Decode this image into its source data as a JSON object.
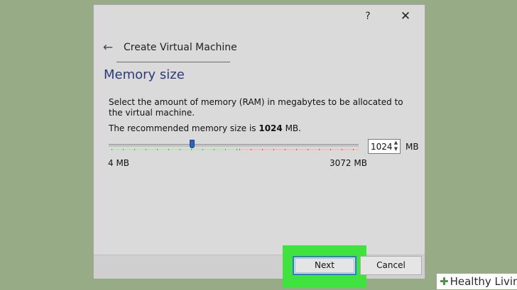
{
  "window": {
    "help_label": "?",
    "close_label": "✕"
  },
  "header": {
    "back_icon": "←",
    "title": "Create Virtual Machine"
  },
  "page": {
    "title": "Memory size",
    "description": "Select the amount of memory (RAM) in megabytes to be allocated to the virtual machine.",
    "recommended_prefix": "The recommended memory size is ",
    "recommended_value": "1024",
    "recommended_suffix": " MB."
  },
  "memory": {
    "value": "1024",
    "unit": "MB",
    "min_label": "4 MB",
    "max_label": "3072 MB",
    "min": 4,
    "max": 3072,
    "current": 1024
  },
  "buttons": {
    "next": "Next",
    "cancel": "Cancel"
  },
  "watermark": {
    "icon": "✚",
    "text": "Healthy Living"
  },
  "colors": {
    "background": "#97ab87",
    "dialog": "#dadada",
    "title": "#2d3a7a",
    "highlight": "#3fe23f",
    "slider_handle": "#2b64b8",
    "tick_safe": "#3bb34a",
    "tick_danger": "#d64b4b"
  }
}
